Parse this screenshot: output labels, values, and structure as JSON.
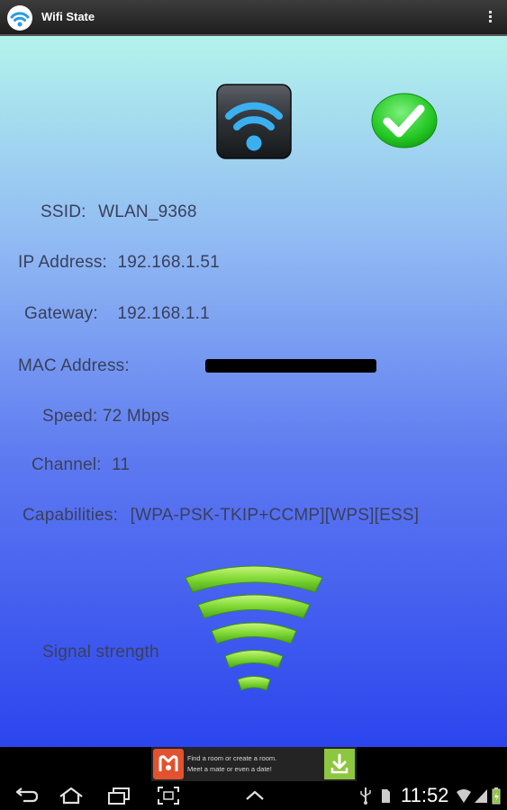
{
  "app": {
    "title": "Wifi State",
    "icon": "wifi-app-icon",
    "menu_icon": "overflow-menu-icon"
  },
  "status": {
    "connected_icon": "green-check-icon",
    "logo_icon": "wifi-logo-icon"
  },
  "info": {
    "ssid_label": "SSID:",
    "ssid_value": "WLAN_9368",
    "ip_label": "IP Address:",
    "ip_value": "192.168.1.51",
    "gateway_label": "Gateway:",
    "gateway_value": "192.168.1.1",
    "mac_label": "MAC Address:",
    "speed_label": "Speed:",
    "speed_value": "72 Mbps",
    "channel_label": "Channel:",
    "channel_value": "11",
    "capabilities_label": "Capabilities:",
    "capabilities_value": "[WPA-PSK-TKIP+CCMP][WPS][ESS]",
    "signal_label": "Signal strength",
    "signal_icon": "signal-strength-icon"
  },
  "ad": {
    "line1": "Find a room or create a room.",
    "line2": "Meet a mate or even a date!",
    "logo_icon": "ad-logo-icon",
    "download_icon": "download-icon"
  },
  "system_bar": {
    "time": "11:52",
    "buttons": [
      "back-icon",
      "home-icon",
      "recent-apps-icon",
      "screenshot-icon",
      "expand-up-icon"
    ],
    "status_icons": [
      "usb-icon",
      "sd-card-icon",
      "wifi-status-icon",
      "signal-bars-icon",
      "battery-icon"
    ]
  },
  "colors": {
    "text": "#3a3f5a",
    "check_green": "#2fcf2f",
    "signal_green": "#7fd833",
    "wifi_blue": "#3bb0f0"
  }
}
